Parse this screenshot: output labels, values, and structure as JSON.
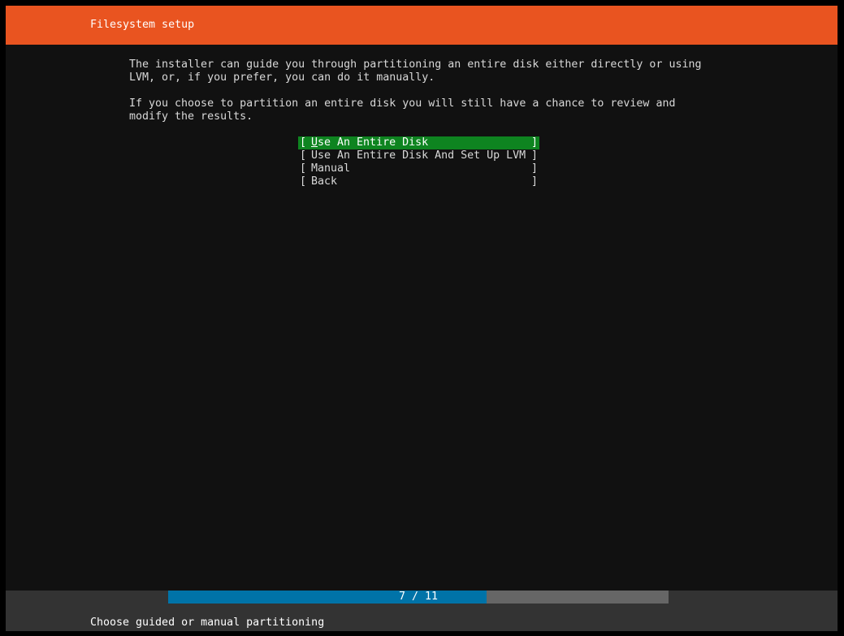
{
  "header": {
    "title": "Filesystem setup"
  },
  "body": {
    "paragraph_1": "The installer can guide you through partitioning an entire disk either directly or using\nLVM, or, if you prefer, you can do it manually.",
    "paragraph_2": "If you choose to partition an entire disk you will still have a chance to review and\nmodify the results."
  },
  "menu": {
    "left_bracket": "[",
    "right_bracket": "]",
    "selected_index": 0,
    "items": [
      {
        "hotkey": "U",
        "rest": "se An Entire Disk"
      },
      {
        "hotkey": "",
        "rest": "Use An Entire Disk And Set Up LVM"
      },
      {
        "hotkey": "",
        "rest": "Manual"
      },
      {
        "hotkey": "",
        "rest": "Back"
      }
    ]
  },
  "progress": {
    "current": 7,
    "total": 11,
    "label": "7 / 11",
    "fraction": 0.6364
  },
  "status": {
    "text": "Choose guided or manual partitioning"
  },
  "colors": {
    "title_bar": "#e95420",
    "selected_item": "#0e8420",
    "progress_fill": "#0073a8",
    "progress_track": "#666666",
    "footer": "#333333",
    "background": "#111111"
  }
}
